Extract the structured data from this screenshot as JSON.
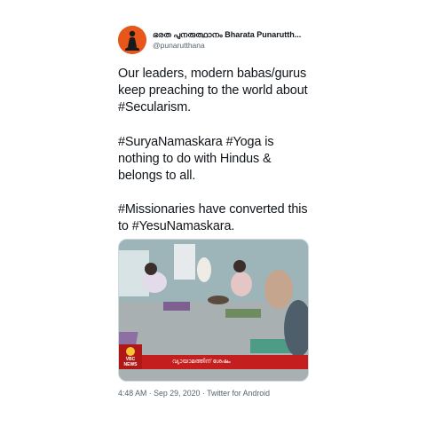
{
  "tweet": {
    "display_name": "ഭരത പുനരുത്ഥാനം Bharata Punarutth...",
    "handle": "@punarutthana",
    "paragraphs": [
      "Our leaders, modern babas/gurus keep preaching to the world about #Secularism.",
      "#SuryaNamaskara #Yoga is nothing to do with Hindus & belongs to all.",
      "#Missionaries have converted this to #YesuNamaskara."
    ],
    "media": {
      "channel_logo": "VBC NEWS",
      "caption": "വ്യായാമത്തിന് ശേഷം"
    },
    "timestamp": "4:48 AM · Sep 29, 2020 · Twitter for Android"
  },
  "colors": {
    "avatar_bg": "#e8561a",
    "text": "#0f1419",
    "muted": "#536471"
  },
  "icons": {
    "avatar": "meditating-figure-avatar"
  }
}
